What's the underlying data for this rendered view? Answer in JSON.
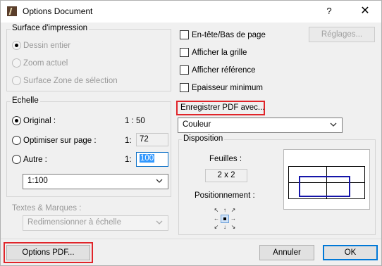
{
  "window": {
    "title": "Options Document",
    "help_label": "?",
    "close_label": "✕"
  },
  "print_area": {
    "group_label": "Surface d'impression",
    "options": [
      {
        "label": "Dessin entier"
      },
      {
        "label": "Zoom actuel"
      },
      {
        "label": "Surface Zone de sélection"
      }
    ]
  },
  "scale": {
    "group_label": "Echelle",
    "original": {
      "label": "Original :",
      "value": "1 : 50"
    },
    "fit_page": {
      "label": "Optimiser sur page :",
      "prefix": "1:",
      "value": "72"
    },
    "other": {
      "label": "Autre :",
      "prefix": "1:",
      "value": "100"
    },
    "preset": "1:100"
  },
  "texts": {
    "group_label": "Textes & Marques :",
    "value": "Redimensionner à échelle"
  },
  "options": {
    "header_footer": "En-tête/Bas de page",
    "show_grid": "Afficher la grille",
    "show_reference": "Afficher référence",
    "min_thickness": "Epaisseur minimum",
    "settings_button": "Réglages..."
  },
  "save_pdf": {
    "label": "Enregistrer PDF avec...",
    "value": "Couleur"
  },
  "layout": {
    "group_label": "Disposition",
    "pages_label": "Feuilles :",
    "pages_value": "2 x 2",
    "positioning_label": "Positionnement :"
  },
  "footer": {
    "pdf_options": "Options PDF...",
    "cancel": "Annuler",
    "ok": "OK"
  },
  "colors": {
    "highlight": "#e0252a",
    "accent": "#0078d7",
    "preview_rect": "#1515a8"
  }
}
